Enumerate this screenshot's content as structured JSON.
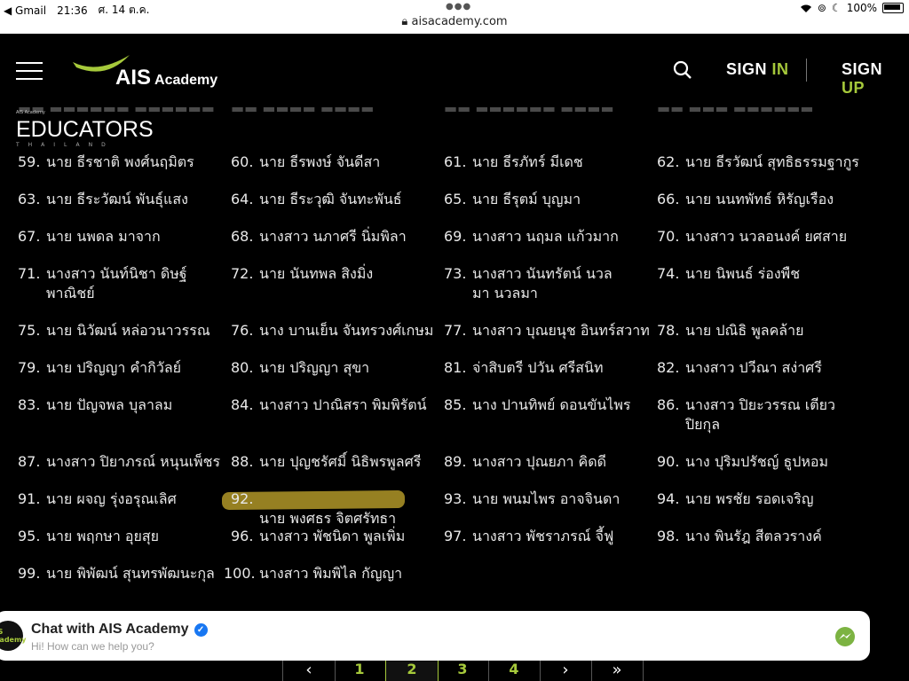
{
  "status_bar": {
    "back_app": "◀ Gmail",
    "time": "21:36",
    "date": "ศ. 14 ต.ค.",
    "url": "aisacademy.com",
    "battery": "100%"
  },
  "header": {
    "logo_ais": "AIS",
    "logo_academy": "Academy",
    "signin_prefix": "SIGN",
    "signin_suffix": "IN",
    "signup_prefix": "SIGN",
    "signup_suffix": "UP",
    "accent_color": "#a6c93b"
  },
  "educators_badge": {
    "small": "AIS Academy",
    "title": "EDUCATORS",
    "sub": "THAILAND"
  },
  "entries": [
    {
      "num": "59.",
      "name": "นาย ธีรชาติ พงศ์นฤมิตร"
    },
    {
      "num": "60.",
      "name": "นาย ธีรพงษ์ จันดีสา"
    },
    {
      "num": "61.",
      "name": "นาย ธีรภัทร์ มีเดช"
    },
    {
      "num": "62.",
      "name": "นาย ธีรวัฒน์ สุทธิธรรมฐากูร"
    },
    {
      "num": "63.",
      "name": "นาย ธีระวัฒน์ พันธุ์แสง"
    },
    {
      "num": "64.",
      "name": "นาย ธีระวุฒิ จันทะพันธ์"
    },
    {
      "num": "65.",
      "name": "นาย ธีรุตม์ บุญมา"
    },
    {
      "num": "66.",
      "name": "นาย นนทพัทธ์ หิรัญเรือง"
    },
    {
      "num": "67.",
      "name": "นาย นพดล มาจาก"
    },
    {
      "num": "68.",
      "name": "นางสาว นภาศรี นิ่มพิลา"
    },
    {
      "num": "69.",
      "name": "นางสาว นฤมล แก้วมาก"
    },
    {
      "num": "70.",
      "name": "นางสาว นวลอนงค์ ยศสาย"
    },
    {
      "num": "71.",
      "name": "นางสาว นันท์นิชา ดิษฐ์พาณิชย์"
    },
    {
      "num": "72.",
      "name": "นาย นันทพล สิงมิ่ง"
    },
    {
      "num": "73.",
      "name": "นางสาว นันทรัตน์ นวลมา นวลมา"
    },
    {
      "num": "74.",
      "name": "นาย นิพนธ์ ร่องพืช"
    },
    {
      "num": "75.",
      "name": "นาย นิวัฒน์ หล่อวนาวรรณ"
    },
    {
      "num": "76.",
      "name": "นาง บานเย็น จันทรวงศ์เกษม"
    },
    {
      "num": "77.",
      "name": "นางสาว บุณยนุช อินทร์สวาท"
    },
    {
      "num": "78.",
      "name": "นาย ปณิธิ พูลคล้าย"
    },
    {
      "num": "79.",
      "name": "นาย ปริญญา คำกิวัลย์"
    },
    {
      "num": "80.",
      "name": "นาย ปริญญา สุขา"
    },
    {
      "num": "81.",
      "name": "จ่าสิบตรี ปวัน ศรีสนิท"
    },
    {
      "num": "82.",
      "name": "นางสาว ปวีณา สง่าศรี"
    },
    {
      "num": "83.",
      "name": "นาย ปัญจพล บุลาลม"
    },
    {
      "num": "84.",
      "name": "นางสาว ปาณิสรา พิมพิรัตน์"
    },
    {
      "num": "85.",
      "name": "นาง ปานทิพย์ ดอนขันไพร"
    },
    {
      "num": "86.",
      "name": "นางสาว ปิยะวรรณ เตียวปิยกุล"
    },
    {
      "num": "87.",
      "name": "นางสาว ปิยาภรณ์ หนุนเพ็ชร"
    },
    {
      "num": "88.",
      "name": "นาย ปุญชรัศมิ์ นิธิพรพูลศรี"
    },
    {
      "num": "89.",
      "name": "นางสาว ปุณยภา คิดดี"
    },
    {
      "num": "90.",
      "name": "นาง ปุริมปรัชญ์ ธูปหอม"
    },
    {
      "num": "91.",
      "name": "นาย ผจญ รุ่งอรุณเลิศ"
    },
    {
      "num": "92.",
      "name": "นาย พงศธร จิตศรัทธา"
    },
    {
      "num": "93.",
      "name": "นาย พนมไพร อาจจินดา"
    },
    {
      "num": "94.",
      "name": "นาย พรชัย รอดเจริญ"
    },
    {
      "num": "95.",
      "name": "นาย พฤกษา อุยสุย"
    },
    {
      "num": "96.",
      "name": "นางสาว พัชนิดา พูลเพิ่ม"
    },
    {
      "num": "97.",
      "name": "นางสาว พัชราภรณ์ จี้ฟู"
    },
    {
      "num": "98.",
      "name": "นาง พินรัฎ สีตลวรางค์"
    },
    {
      "num": "99.",
      "name": "นาย พิพัฒน์ สุนทรพัฒนะกุล"
    },
    {
      "num": "100.",
      "name": "นางสาว พิมพิไล กัญญา"
    }
  ],
  "chat": {
    "title": "Chat with AIS Academy",
    "subtitle": "Hi! How can we help you?",
    "avatar_text": "AIS Academy",
    "verified_mark": "✓"
  },
  "pagination": {
    "prev": "‹",
    "pages": [
      "1",
      "2",
      "3",
      "4"
    ],
    "current": "2",
    "next": "›",
    "last": "»"
  }
}
